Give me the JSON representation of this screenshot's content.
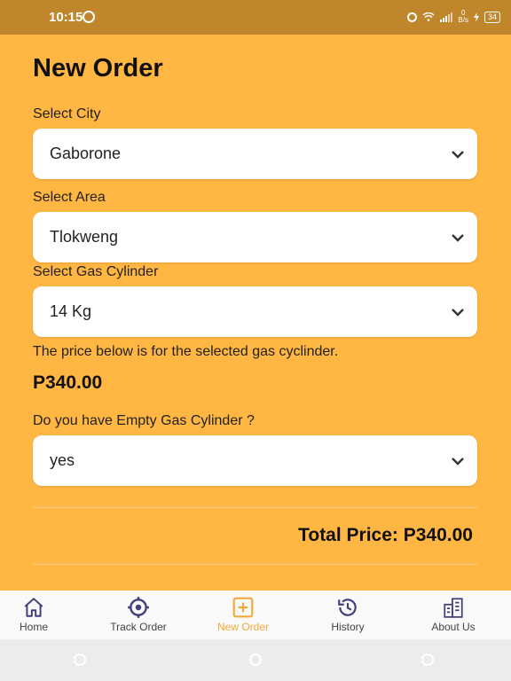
{
  "status_bar": {
    "time": "10:15",
    "speed_top": "0",
    "speed_bottom": "B/s",
    "battery": "34"
  },
  "page": {
    "title": "New Order"
  },
  "form": {
    "city": {
      "label": "Select City",
      "value": "Gaborone"
    },
    "area": {
      "label": "Select Area",
      "value": "Tlokweng"
    },
    "cylinder": {
      "label": "Select Gas Cylinder",
      "value": "14 Kg"
    },
    "price_note": "The price below is for the selected gas cyclinder.",
    "price": "P340.00",
    "empty_cylinder": {
      "label": "Do you have Empty Gas Cylinder ?",
      "value": "yes"
    },
    "total_label": "Total Price:",
    "total_value": "P340.00"
  },
  "bottom_nav": {
    "items": [
      {
        "label": "Home",
        "icon": "home-icon"
      },
      {
        "label": "Track Order",
        "icon": "crosshair-icon"
      },
      {
        "label": "New Order",
        "icon": "plus-square-icon",
        "active": true
      },
      {
        "label": "History",
        "icon": "history-icon"
      },
      {
        "label": "About Us",
        "icon": "building-icon"
      }
    ]
  },
  "colors": {
    "background": "#ffb642",
    "status_bar": "#c0862c",
    "active_nav": "#f2a93b",
    "nav_icon": "#3f3f7a"
  }
}
